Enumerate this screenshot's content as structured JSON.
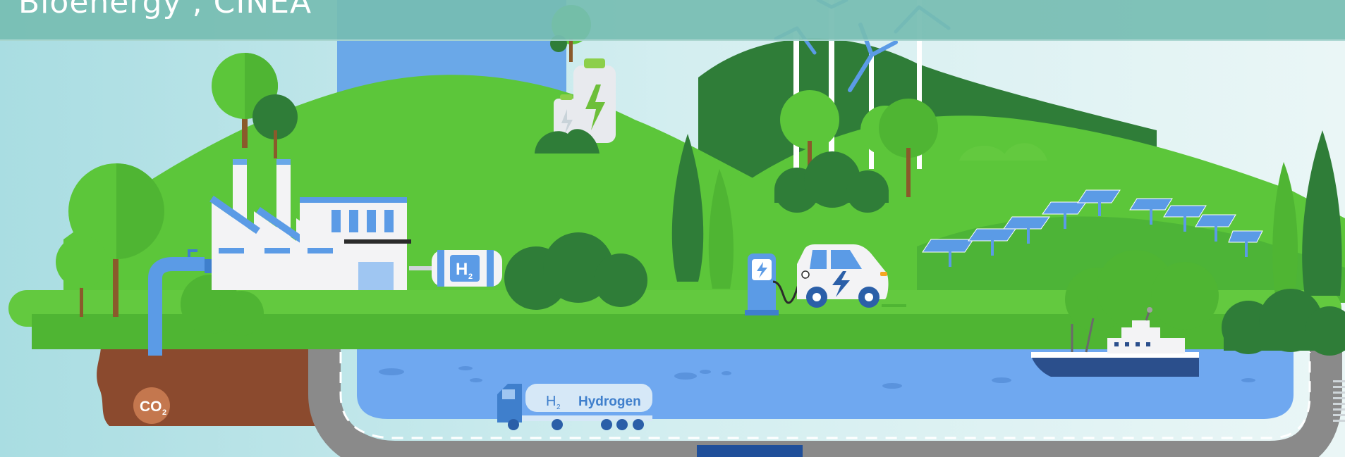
{
  "header": {
    "title": "Bioenergy , CINEA"
  },
  "labels": {
    "co2": "CO",
    "co2_sub": "2",
    "h2_tank": "H",
    "h2_tank_sub": "2",
    "truck_h": "H",
    "truck_h_sub": "2",
    "truck_word": "Hydrogen"
  },
  "colors": {
    "sky": "#bfe6ea",
    "grass": "#5cc63a",
    "dark_green": "#2f7d38",
    "water": "#6fa8f0",
    "road": "#8a8a8a",
    "soil": "#8b4a2e",
    "header": "#76bdb2"
  },
  "icons": [
    "factory-icon",
    "hydrogen-tank-icon",
    "battery-icon",
    "wind-turbine-icon",
    "solar-panel-icon",
    "charging-station-icon",
    "electric-car-icon",
    "hydrogen-truck-icon",
    "ship-icon",
    "co2-bubble-icon",
    "pipe-icon",
    "tree-icon"
  ]
}
